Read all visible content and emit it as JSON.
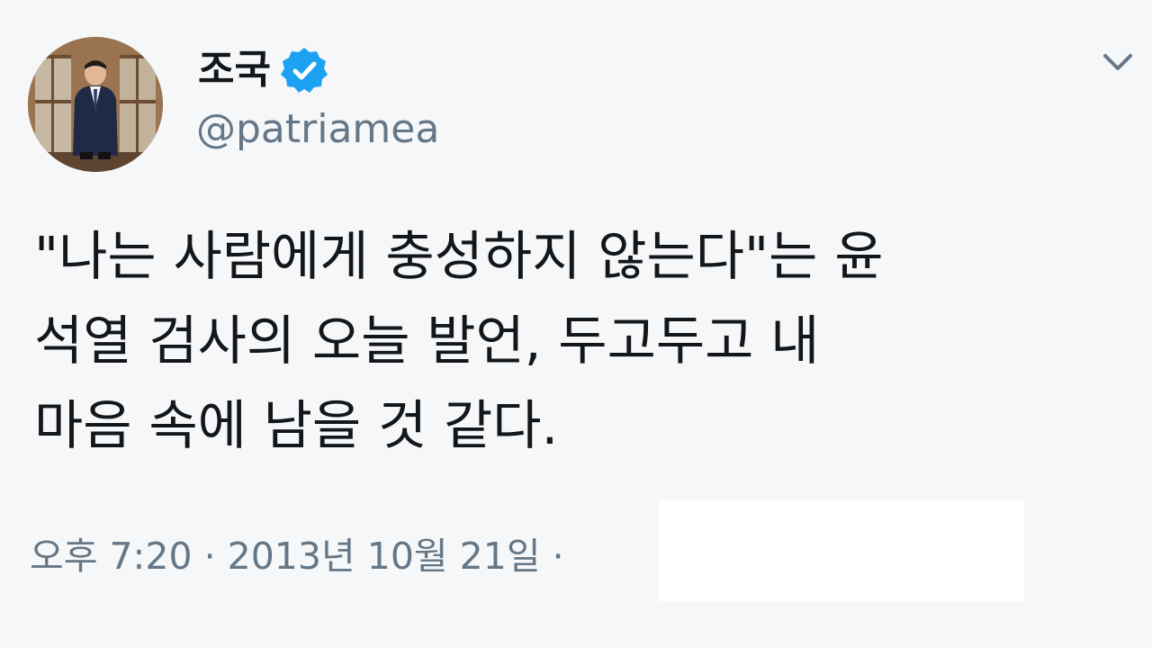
{
  "author": {
    "display_name": "조국",
    "handle": "@patriamea",
    "verified": true,
    "avatar_icon": "profile-photo"
  },
  "tweet": {
    "text": "\"나는 사람에게 충성하지 않는다\"는 윤\n석열 검사의 오늘 발언, 두고두고 내\n마음 속에 남을 것 같다.",
    "timestamp": "오후 7:20 · 2013년 10월 21일 ·"
  },
  "icons": {
    "verified": "verified-badge-icon",
    "menu": "chevron-down-icon"
  },
  "colors": {
    "verified_blue": "#1da1f2",
    "text_primary": "#14171a",
    "text_secondary": "#657786"
  }
}
